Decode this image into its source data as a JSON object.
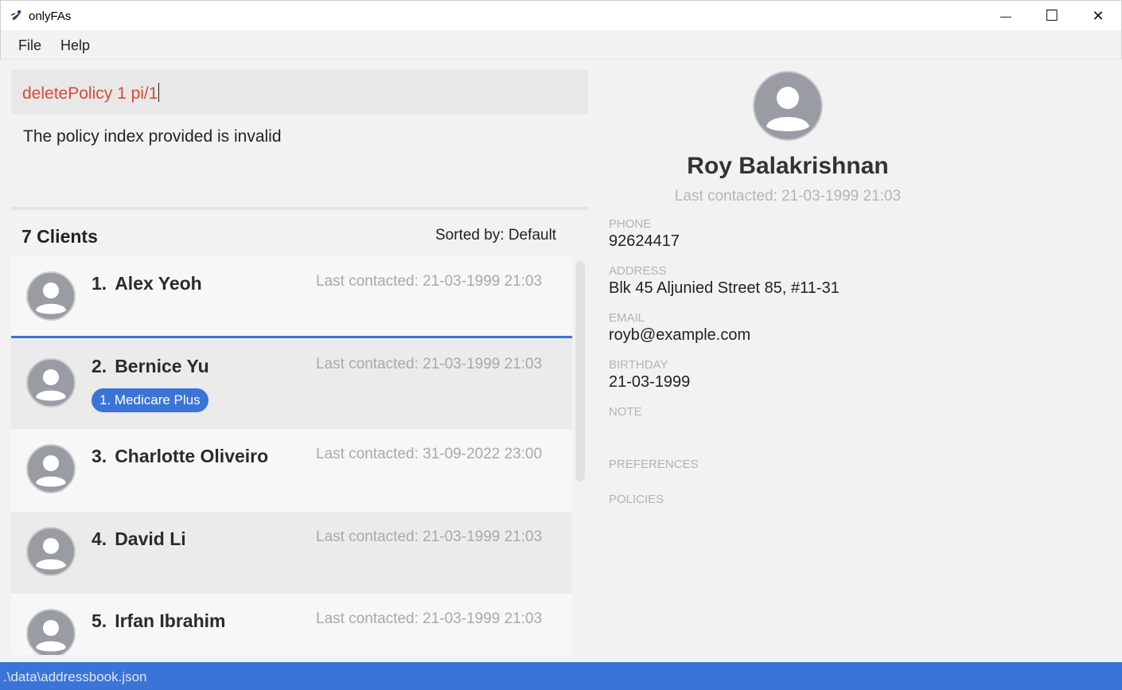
{
  "window": {
    "title": "onlyFAs",
    "minimize_glyph": "—",
    "maximize_glyph": "☐",
    "close_glyph": "✕"
  },
  "menu": {
    "file": "File",
    "help": "Help"
  },
  "command": {
    "value": "deletePolicy 1 pi/1"
  },
  "result": {
    "message": "The policy index provided is invalid"
  },
  "client_list": {
    "count_label": "7 Clients",
    "sort_label": "Sorted by: Default",
    "items": [
      {
        "index": "1.",
        "name": "Alex Yeoh",
        "last_contacted": "Last contacted: 21-03-1999 21:03",
        "tags": []
      },
      {
        "index": "2.",
        "name": "Bernice Yu",
        "last_contacted": "Last contacted: 21-03-1999 21:03",
        "tags": [
          "1. Medicare Plus"
        ]
      },
      {
        "index": "3.",
        "name": "Charlotte Oliveiro",
        "last_contacted": "Last contacted: 31-09-2022 23:00",
        "tags": []
      },
      {
        "index": "4.",
        "name": "David Li",
        "last_contacted": "Last contacted: 21-03-1999 21:03",
        "tags": []
      },
      {
        "index": "5.",
        "name": "Irfan Ibrahim",
        "last_contacted": "Last contacted: 21-03-1999 21:03",
        "tags": []
      }
    ]
  },
  "detail": {
    "name": "Roy Balakrishnan",
    "last_contacted": "Last contacted: 21-03-1999 21:03",
    "phone_label": "PHONE",
    "phone": "92624417",
    "address_label": "ADDRESS",
    "address": "Blk 45 Aljunied Street 85, #11-31",
    "email_label": "EMAIL",
    "email": "royb@example.com",
    "birthday_label": "BIRTHDAY",
    "birthday": "21-03-1999",
    "note_label": "NOTE",
    "preferences_label": "PREFERENCES",
    "policies_label": "POLICIES"
  },
  "status": {
    "path": ".\\data\\addressbook.json"
  },
  "colors": {
    "accent": "#3a74d6",
    "command_text": "#d84a36"
  },
  "icons": {
    "app": "app-logo-icon",
    "avatar": "user-avatar-icon"
  }
}
